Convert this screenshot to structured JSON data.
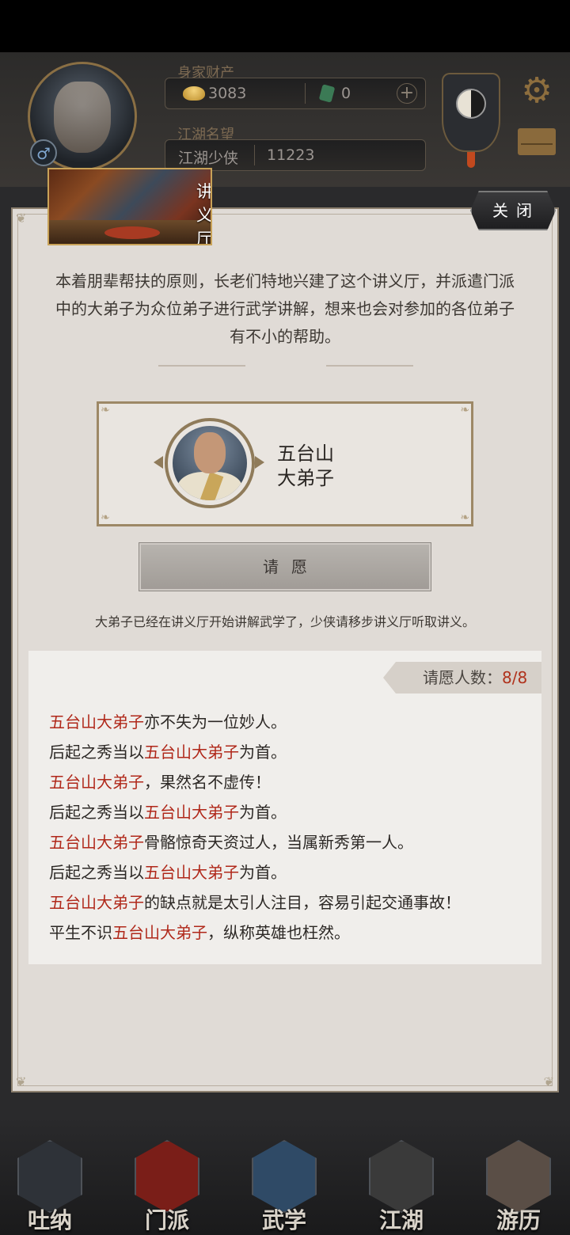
{
  "header": {
    "wealth_label": "身家财产",
    "gold": "3083",
    "jade": "0",
    "plus": "+",
    "fame_label": "江湖名望",
    "title": "江湖少侠",
    "fame_value": "11223",
    "gender_symbol": "♂",
    "settings_icon": "gear-icon",
    "mail_icon": "mail-icon"
  },
  "modal": {
    "hall_title": "讲义厅",
    "close_label": "关闭",
    "intro": "本着朋辈帮扶的原则，长老们特地兴建了这个讲义厅，并派遣门派中的大弟子为众位弟子进行武学讲解，想来也会对参加的各位弟子有不小的帮助。",
    "master": {
      "line1": "五台山",
      "line2": "大弟子"
    },
    "wish_button": "请愿",
    "notice": "大弟子已经在讲义厅开始讲解武学了，少侠请移步讲义厅听取讲义。",
    "wish_count_label": "请愿人数：",
    "wish_count_value": "8/8",
    "wishes": [
      {
        "pre": "",
        "hl": "五台山大弟子",
        "post": "亦不失为一位妙人。"
      },
      {
        "pre": "后起之秀当以",
        "hl": "五台山大弟子",
        "post": "为首。"
      },
      {
        "pre": "",
        "hl": "五台山大弟子",
        "post": "，果然名不虚传！"
      },
      {
        "pre": "后起之秀当以",
        "hl": "五台山大弟子",
        "post": "为首。"
      },
      {
        "pre": "",
        "hl": "五台山大弟子",
        "post": "骨骼惊奇天资过人，当属新秀第一人。"
      },
      {
        "pre": "后起之秀当以",
        "hl": "五台山大弟子",
        "post": "为首。"
      },
      {
        "pre": "",
        "hl": "五台山大弟子",
        "post": "的缺点就是太引人注目，容易引起交通事故！"
      },
      {
        "pre": "平生不识",
        "hl": "五台山大弟子",
        "post": "，纵称英雄也枉然。"
      }
    ]
  },
  "nav": [
    {
      "label": "吐纳"
    },
    {
      "label": "门派"
    },
    {
      "label": "武学"
    },
    {
      "label": "江湖"
    },
    {
      "label": "游历"
    }
  ],
  "colors": {
    "highlight": "#b0281a",
    "accent_gold": "#c8a258"
  }
}
